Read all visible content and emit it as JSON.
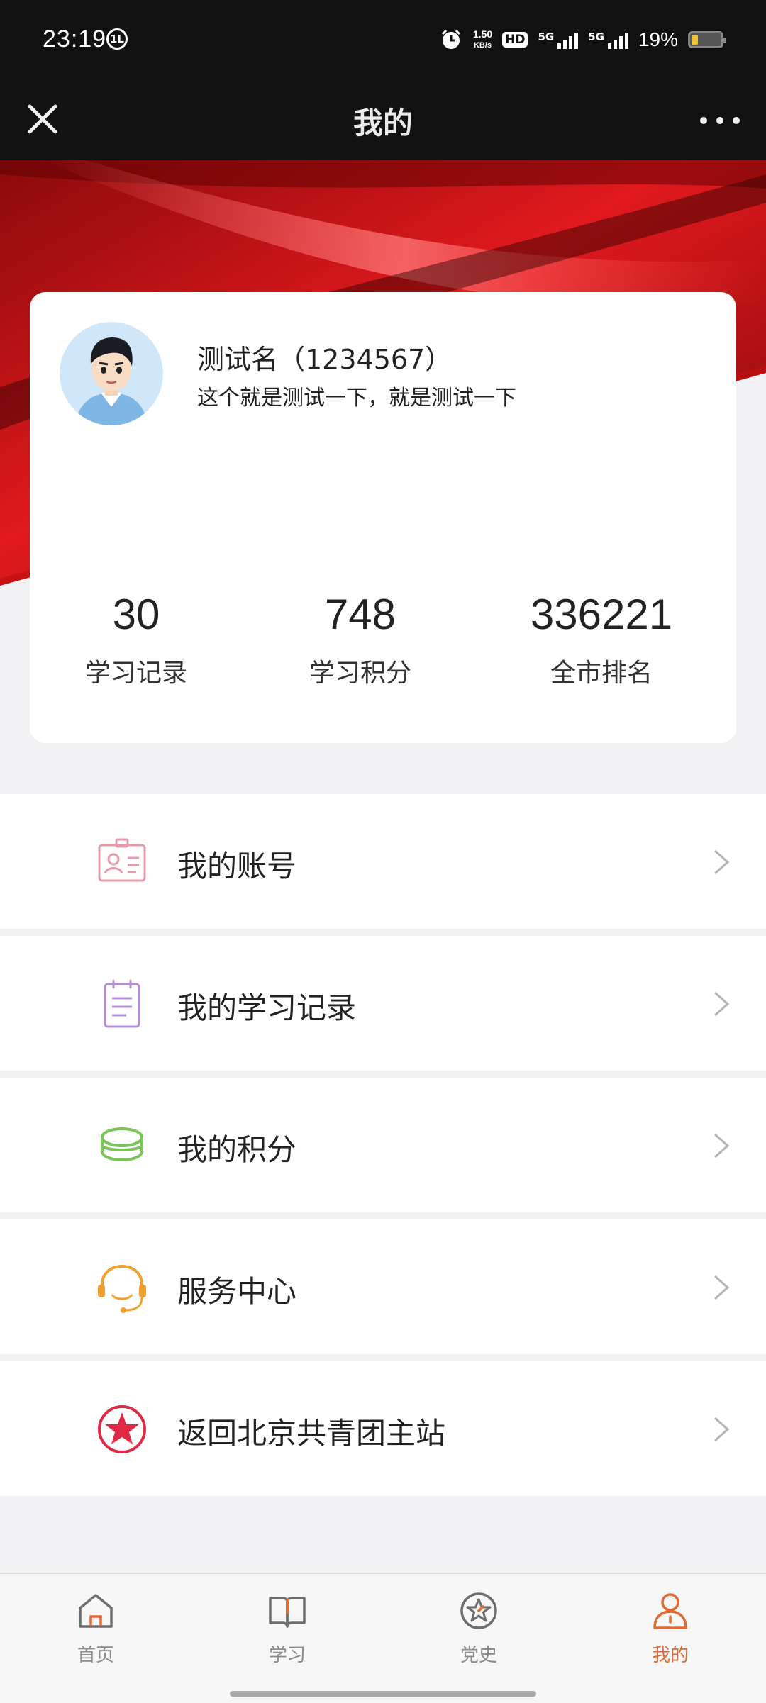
{
  "status_bar": {
    "time": "23:19",
    "badge": "1L",
    "net_speed_value": "1.50",
    "net_speed_unit": "KB/s",
    "hd_label": "HD",
    "sim1_network": "5G",
    "sim2_network": "5G",
    "battery_percent": "19%",
    "battery_level": 0.19
  },
  "header": {
    "title": "我的"
  },
  "profile": {
    "name": "测试名（1234567）",
    "bio": "这个就是测试一下，就是测试一下",
    "stats": [
      {
        "value": "30",
        "label": "学习记录"
      },
      {
        "value": "748",
        "label": "学习积分"
      },
      {
        "value": "336221",
        "label": "全市排名"
      }
    ]
  },
  "menu": {
    "items": [
      {
        "label": "我的账号",
        "icon": "id-card-icon",
        "color": "#e99aa8"
      },
      {
        "label": "我的学习记录",
        "icon": "notepad-icon",
        "color": "#b48fd6"
      },
      {
        "label": "我的积分",
        "icon": "coins-icon",
        "color": "#7cc35a"
      },
      {
        "label": "服务中心",
        "icon": "headset-icon",
        "color": "#f0a030"
      },
      {
        "label": "返回北京共青团主站",
        "icon": "red-star-icon",
        "color": "#e02a45"
      }
    ]
  },
  "tabbar": {
    "tabs": [
      {
        "label": "首页",
        "icon": "home-icon",
        "active": false
      },
      {
        "label": "学习",
        "icon": "book-icon",
        "active": false
      },
      {
        "label": "党史",
        "icon": "star-badge-icon",
        "active": false
      },
      {
        "label": "我的",
        "icon": "person-icon",
        "active": true
      }
    ],
    "active_color": "#e06a33",
    "inactive_color": "#8c8c8c"
  }
}
